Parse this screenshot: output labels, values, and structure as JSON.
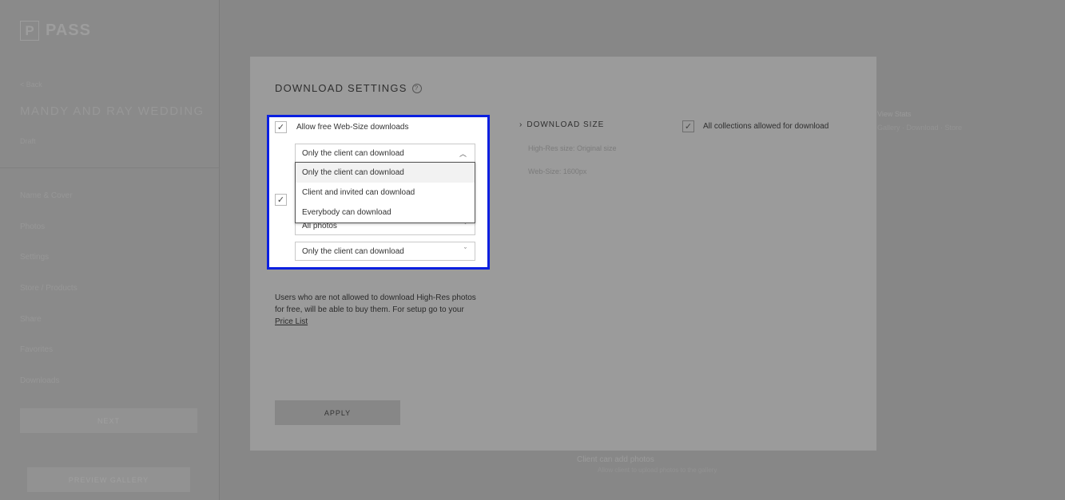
{
  "app": {
    "logo_letter": "P",
    "logo_text": "PASS",
    "back_label": "< Back",
    "gallery_title": "MANDY AND RAY WEDDING",
    "gallery_sub": "Draft",
    "nav": [
      "Name & Cover",
      "Photos",
      "Settings",
      "Store / Products",
      "Share",
      "Favorites",
      "Downloads"
    ],
    "primary_button": "NEXT",
    "preview_button": "PREVIEW GALLERY",
    "bg_right_1": "View Stats",
    "bg_right_2": "Gallery  ·  Download  ·  Store",
    "bg_bottom_1": "Client can add photos",
    "bg_bottom_2": "Allow client to upload photos to the gallery"
  },
  "modal": {
    "title": "DOWNLOAD SETTINGS",
    "help_icon": "?",
    "webSize": {
      "checked": true,
      "label": "Allow free Web-Size downloads",
      "select_value": "Only the client can download"
    },
    "dropdown_options": [
      "Only the client can download",
      "Client and invited can download",
      "Everybody can download"
    ],
    "highRes": {
      "checked": true,
      "photos_select": "All photos",
      "who_select": "Only the client can download"
    },
    "info_text": "Users who are not allowed to download High-Res photos for free, will be able to buy them. For setup go to your",
    "info_link": "Price List",
    "apply_label": "APPLY",
    "download_size_header": "DOWNLOAD SIZE",
    "highres_size": "High-Res size: Original size",
    "websize": "Web-Size: 1600px",
    "all_collections_label": "All collections allowed for download"
  }
}
